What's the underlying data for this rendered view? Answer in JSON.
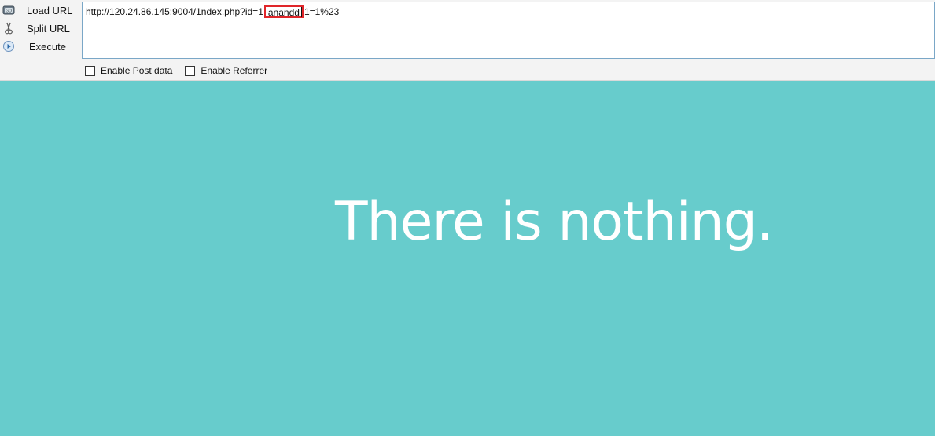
{
  "toolbar": {
    "load_url_label": "Load URL",
    "split_url_label": "Split URL",
    "execute_label": "Execute",
    "icons": {
      "load": "load-url-icon",
      "split": "scissors-icon",
      "execute": "play-circle-icon"
    }
  },
  "url_bar": {
    "prefix": "http://120.24.86.145:9004/1ndex.php?id=1",
    "highlighted": "anand",
    "after_highlight": "d",
    "suffix": "1=1%23",
    "highlight_color": "#e0262a"
  },
  "options": {
    "post_data_label": "Enable Post data",
    "referrer_label": "Enable Referrer",
    "post_data_checked": false,
    "referrer_checked": false
  },
  "page": {
    "message": "There is nothing.",
    "background_color": "#67cccc"
  }
}
